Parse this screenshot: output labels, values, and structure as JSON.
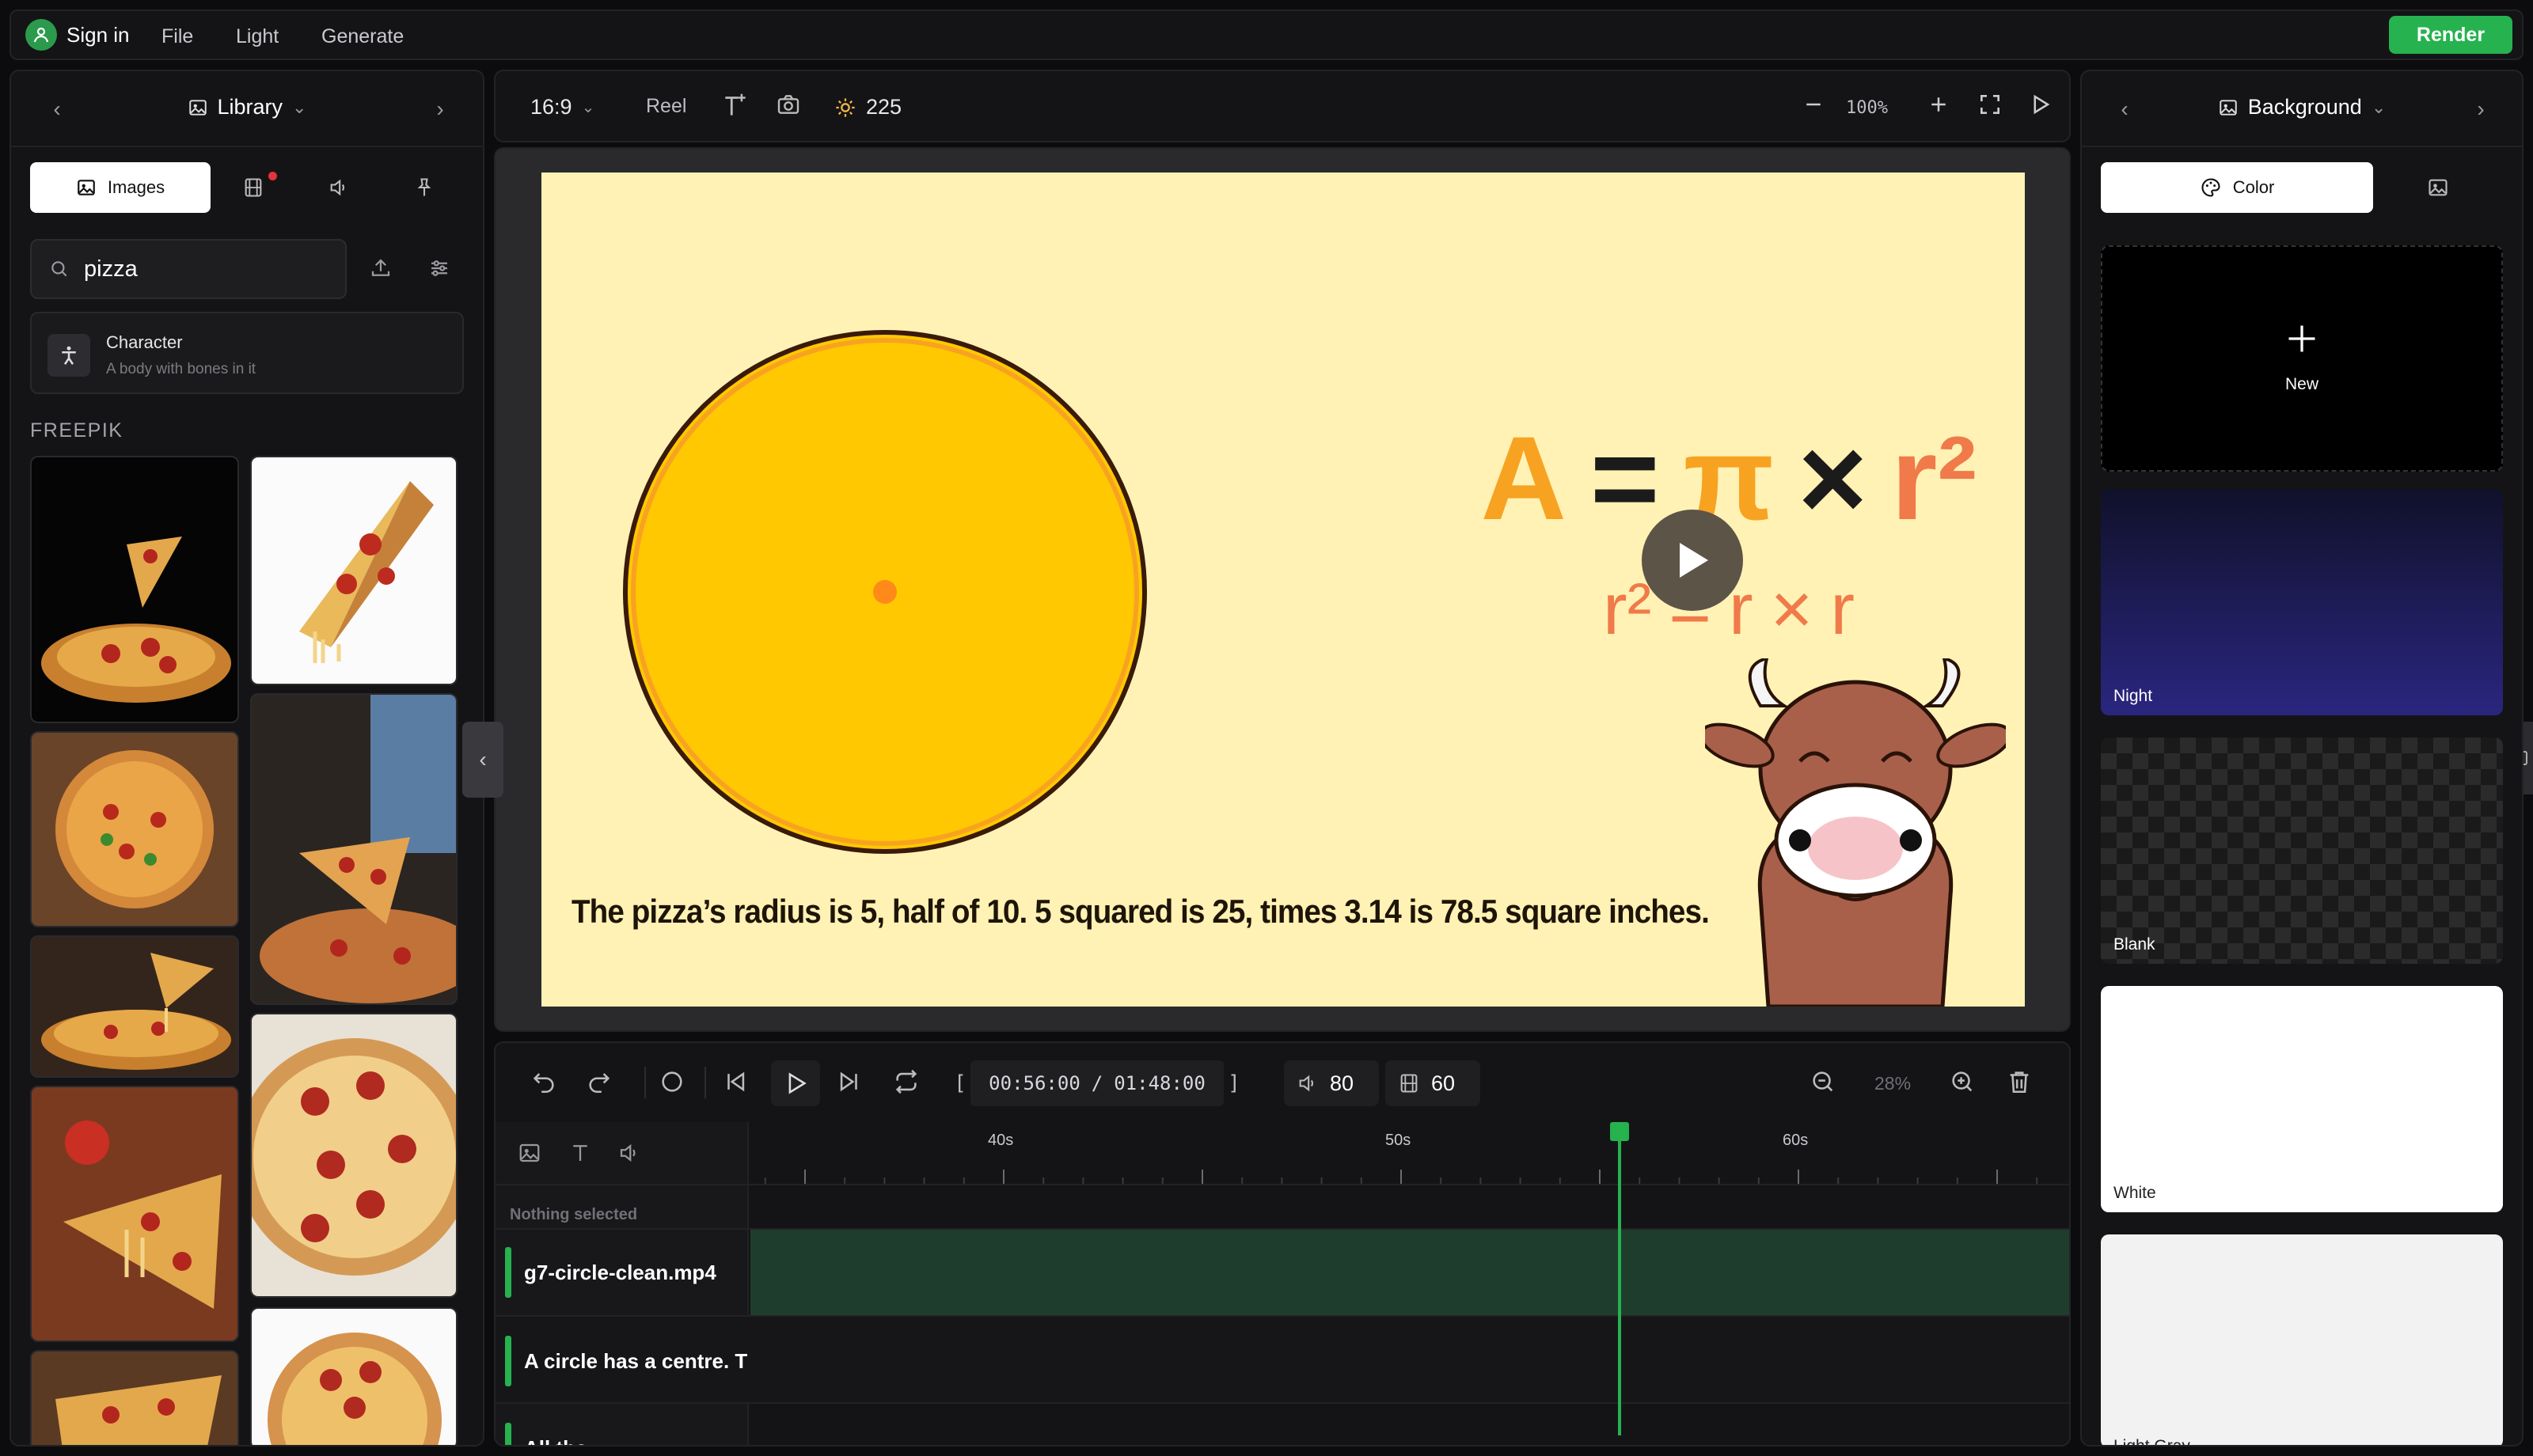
{
  "topbar": {
    "signin": "Sign in",
    "menu": [
      "File",
      "Light",
      "Generate"
    ],
    "render": "Render"
  },
  "library": {
    "title": "Library",
    "tabs": {
      "images": "Images"
    },
    "search_value": "pizza",
    "character": {
      "title": "Character",
      "subtitle": "A body with bones in it"
    },
    "section": "FREEPIK"
  },
  "toolbar": {
    "aspect": "16:9",
    "reel": "Reel",
    "brightness": "225",
    "zoom": "100%"
  },
  "stage": {
    "formula_main": [
      "A",
      "=",
      "π",
      "×",
      "r²"
    ],
    "formula_sub": [
      "r²",
      "=",
      "r",
      "×",
      "r"
    ],
    "subtitle": "The pizza’s radius is 5, half of 10. 5 squared is 25, times 3.14 is 78.5 square inches.",
    "colors": {
      "background": "#fff2b4",
      "circle": "#ffc800",
      "accent": "#f7a321",
      "formula_op": "#1b1b1b"
    }
  },
  "timeline": {
    "timecode_current": "00:56:00",
    "timecode_separator": "/",
    "timecode_total": "01:48:00",
    "bracket_open": "[",
    "bracket_close": "]",
    "volume": "80",
    "fps": "60",
    "zoom": "28%",
    "ruler": [
      "40s",
      "50s",
      "60s"
    ],
    "nothing_selected": "Nothing selected",
    "tracks": [
      "g7-circle-clean.mp4",
      "A circle has a centre. T",
      "All the"
    ],
    "playhead_seconds": 55.5
  },
  "background": {
    "title": "Background",
    "tab_color": "Color",
    "new_label": "New",
    "presets": [
      "Night",
      "Blank",
      "White",
      "Light Gray"
    ]
  }
}
